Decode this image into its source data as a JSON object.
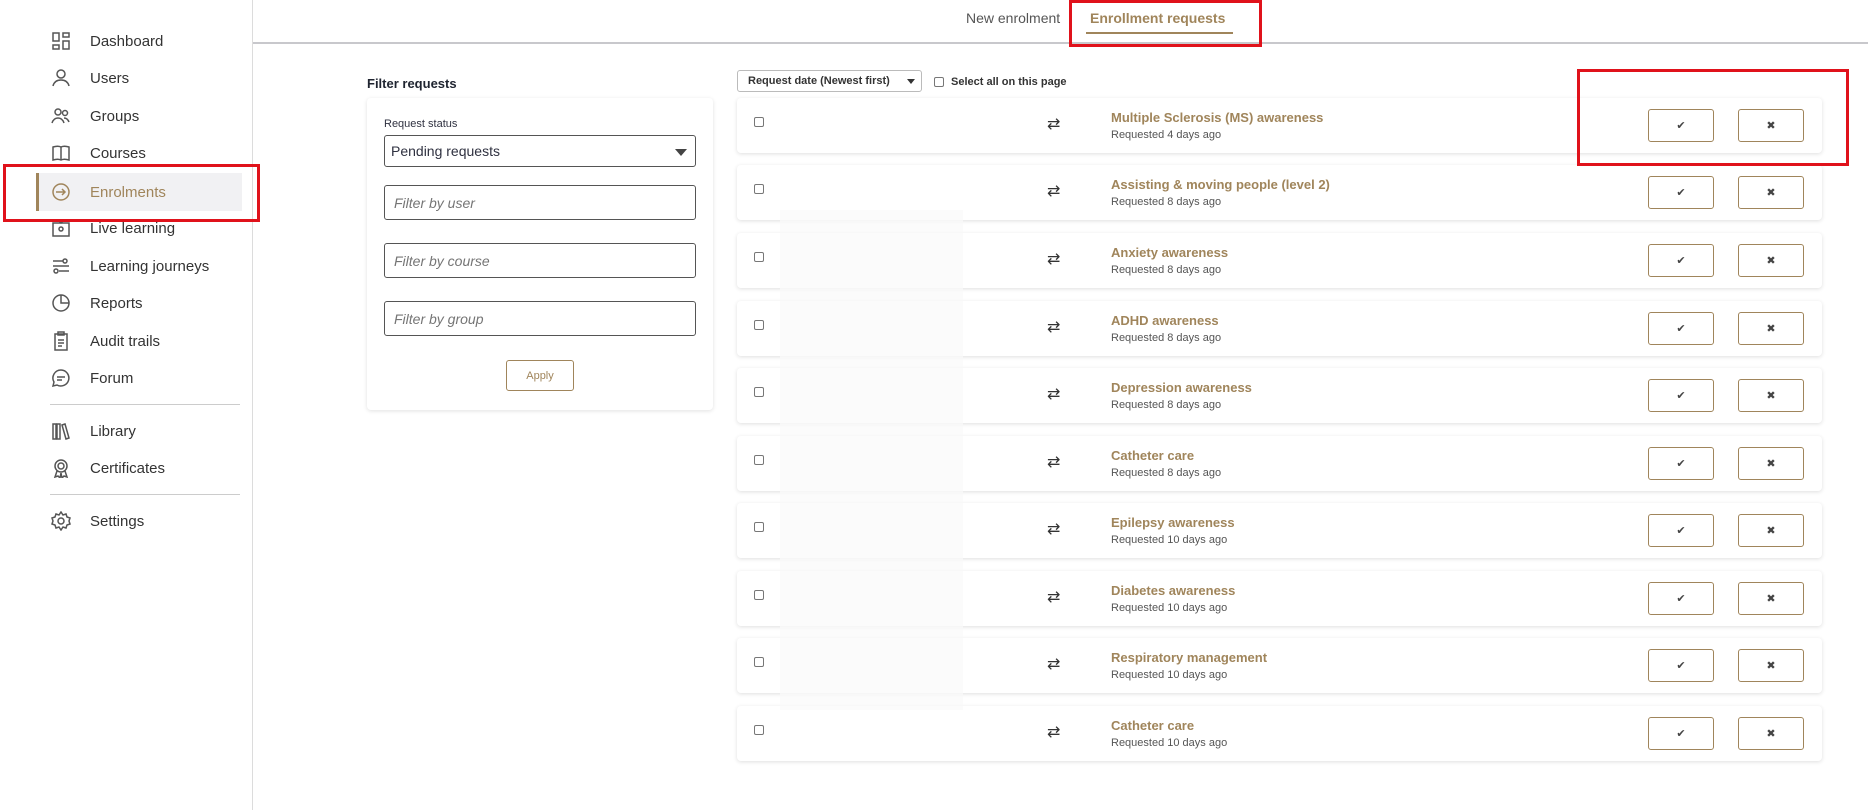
{
  "sidebar": {
    "items": [
      {
        "label": "Dashboard",
        "icon": "dashboard-icon"
      },
      {
        "label": "Users",
        "icon": "user-icon"
      },
      {
        "label": "Groups",
        "icon": "groups-icon"
      },
      {
        "label": "Courses",
        "icon": "book-icon"
      },
      {
        "label": "Enrolments",
        "icon": "enrol-icon",
        "active": true
      },
      {
        "label": "Live learning",
        "icon": "live-icon"
      },
      {
        "label": "Learning journeys",
        "icon": "journey-icon"
      },
      {
        "label": "Reports",
        "icon": "reports-icon"
      },
      {
        "label": "Audit trails",
        "icon": "clipboard-icon"
      },
      {
        "label": "Forum",
        "icon": "chat-icon"
      },
      {
        "label": "Library",
        "icon": "library-icon"
      },
      {
        "label": "Certificates",
        "icon": "certificate-icon"
      },
      {
        "label": "Settings",
        "icon": "gear-icon"
      }
    ]
  },
  "tabs": {
    "new_enrolment": "New enrolment",
    "enrollment_requests": "Enrollment requests"
  },
  "filter": {
    "title": "Filter requests",
    "status_label": "Request status",
    "status_value": "Pending requests",
    "user_placeholder": "Filter by user",
    "course_placeholder": "Filter by course",
    "group_placeholder": "Filter by group",
    "apply_label": "Apply"
  },
  "list": {
    "sort_label": "Request date (Newest first)",
    "select_all_label": "Select all on this page",
    "swap_glyph": "⇄",
    "approve_glyph": "✔",
    "reject_glyph": "✖",
    "requests": [
      {
        "course": "Multiple Sclerosis (MS) awareness",
        "requested": "Requested 4 days ago"
      },
      {
        "course": "Assisting & moving people (level 2)",
        "requested": "Requested 8 days ago"
      },
      {
        "course": "Anxiety awareness",
        "requested": "Requested 8 days ago"
      },
      {
        "course": "ADHD awareness",
        "requested": "Requested 8 days ago"
      },
      {
        "course": "Depression awareness",
        "requested": "Requested 8 days ago"
      },
      {
        "course": "Catheter care",
        "requested": "Requested 8 days ago"
      },
      {
        "course": "Epilepsy awareness",
        "requested": "Requested 10 days ago"
      },
      {
        "course": "Diabetes awareness",
        "requested": "Requested 10 days ago"
      },
      {
        "course": "Respiratory management",
        "requested": "Requested 10 days ago"
      },
      {
        "course": "Catheter care",
        "requested": "Requested 10 days ago"
      }
    ]
  },
  "colors": {
    "accent": "#a0855b",
    "highlight": "#e0121b"
  }
}
